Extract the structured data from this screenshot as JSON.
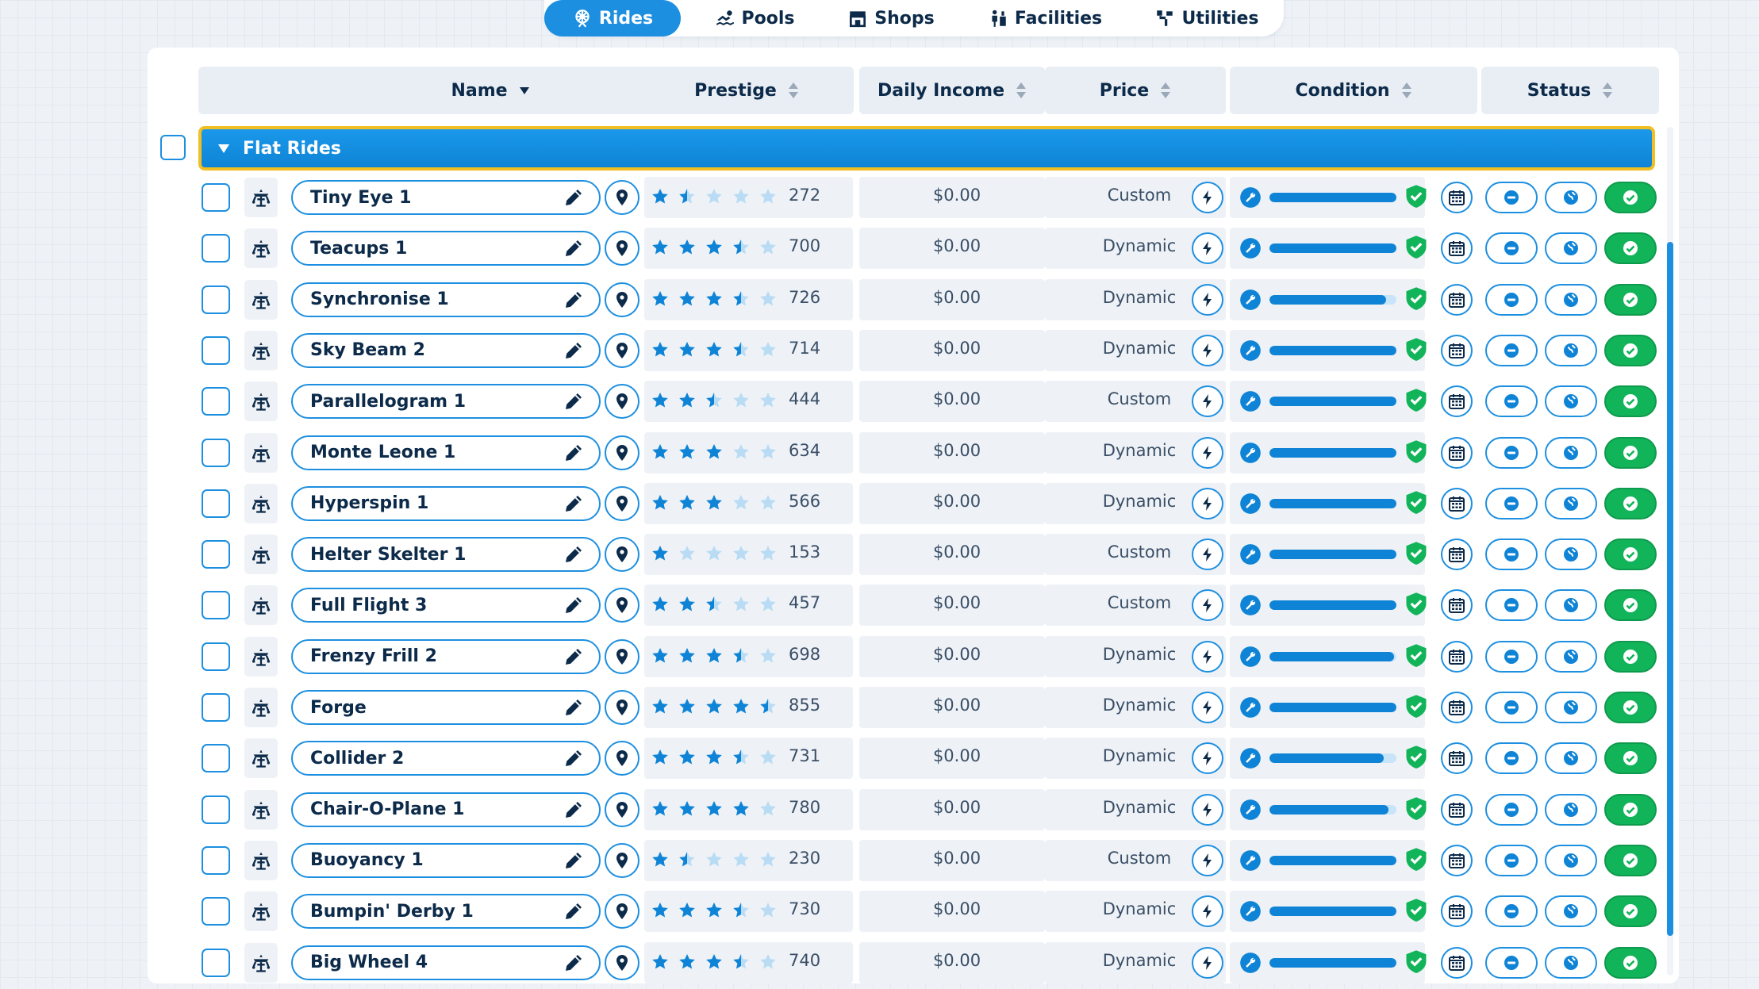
{
  "tabs": [
    {
      "label": "Rides",
      "icon": "ferris-wheel-icon",
      "active": true
    },
    {
      "label": "Pools",
      "icon": "swimmer-icon",
      "active": false
    },
    {
      "label": "Shops",
      "icon": "shop-icon",
      "active": false
    },
    {
      "label": "Facilities",
      "icon": "facilities-icon",
      "active": false
    },
    {
      "label": "Utilities",
      "icon": "utilities-icon",
      "active": false
    }
  ],
  "columns": {
    "name": "Name",
    "prestige": "Prestige",
    "daily_income": "Daily Income",
    "price": "Price",
    "condition": "Condition",
    "status": "Status"
  },
  "group": {
    "label": "Flat Rides",
    "expanded": true
  },
  "colors": {
    "accent": "#1d8fe0",
    "star_empty": "#b9dcf4",
    "status_green": "#12b45a",
    "highlight": "#f2bf22"
  },
  "rides": [
    {
      "name": "Tiny Eye 1",
      "stars": 1.5,
      "prestige": "272",
      "income": "$0.00",
      "price": "Custom",
      "condition": 1.0
    },
    {
      "name": "Teacups 1",
      "stars": 3.5,
      "prestige": "700",
      "income": "$0.00",
      "price": "Dynamic",
      "condition": 1.0
    },
    {
      "name": "Synchronise 1",
      "stars": 3.5,
      "prestige": "726",
      "income": "$0.00",
      "price": "Dynamic",
      "condition": 0.92
    },
    {
      "name": "Sky Beam 2",
      "stars": 3.5,
      "prestige": "714",
      "income": "$0.00",
      "price": "Dynamic",
      "condition": 1.0
    },
    {
      "name": "Parallelogram 1",
      "stars": 2.5,
      "prestige": "444",
      "income": "$0.00",
      "price": "Custom",
      "condition": 1.0
    },
    {
      "name": "Monte Leone 1",
      "stars": 3,
      "prestige": "634",
      "income": "$0.00",
      "price": "Dynamic",
      "condition": 1.0
    },
    {
      "name": "Hyperspin 1",
      "stars": 3,
      "prestige": "566",
      "income": "$0.00",
      "price": "Dynamic",
      "condition": 1.0
    },
    {
      "name": "Helter Skelter 1",
      "stars": 1,
      "prestige": "153",
      "income": "$0.00",
      "price": "Custom",
      "condition": 1.0
    },
    {
      "name": "Full Flight 3",
      "stars": 2.5,
      "prestige": "457",
      "income": "$0.00",
      "price": "Custom",
      "condition": 1.0
    },
    {
      "name": "Frenzy Frill 2",
      "stars": 3.5,
      "prestige": "698",
      "income": "$0.00",
      "price": "Dynamic",
      "condition": 0.98
    },
    {
      "name": "Forge",
      "stars": 4.5,
      "prestige": "855",
      "income": "$0.00",
      "price": "Dynamic",
      "condition": 1.0
    },
    {
      "name": "Collider 2",
      "stars": 3.5,
      "prestige": "731",
      "income": "$0.00",
      "price": "Dynamic",
      "condition": 0.9
    },
    {
      "name": "Chair-O-Plane 1",
      "stars": 4,
      "prestige": "780",
      "income": "$0.00",
      "price": "Dynamic",
      "condition": 0.94
    },
    {
      "name": "Buoyancy 1",
      "stars": 1.5,
      "prestige": "230",
      "income": "$0.00",
      "price": "Custom",
      "condition": 1.0
    },
    {
      "name": "Bumpin' Derby 1",
      "stars": 3.5,
      "prestige": "730",
      "income": "$0.00",
      "price": "Dynamic",
      "condition": 1.0
    },
    {
      "name": "Big Wheel 4",
      "stars": 3.5,
      "prestige": "740",
      "income": "$0.00",
      "price": "Dynamic",
      "condition": 1.0
    }
  ]
}
